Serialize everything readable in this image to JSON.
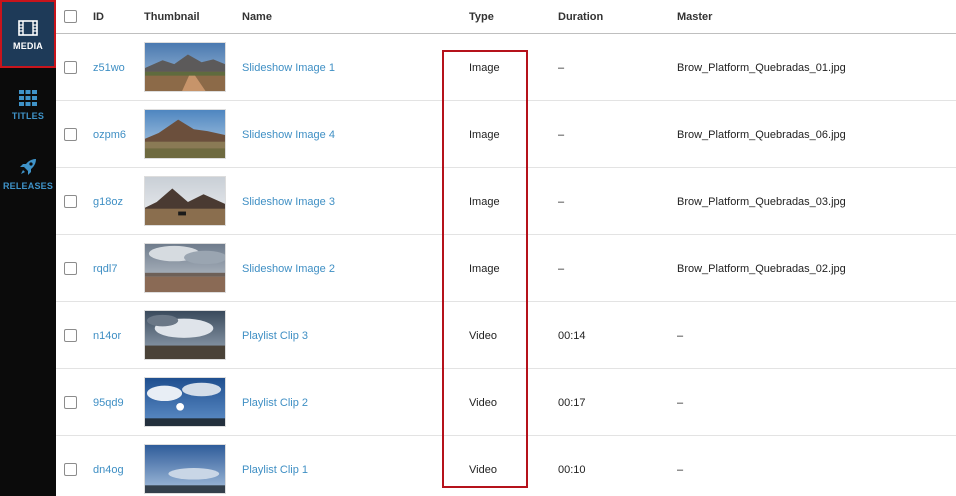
{
  "sidebar": {
    "items": [
      {
        "label": "MEDIA",
        "icon": "film-icon",
        "active": true
      },
      {
        "label": "TITLES",
        "icon": "grid-icon"
      },
      {
        "label": "RELEASES",
        "icon": "rocket-icon"
      }
    ]
  },
  "table": {
    "columns": [
      "ID",
      "Thumbnail",
      "Name",
      "Type",
      "Duration",
      "Master"
    ],
    "rows": [
      {
        "id": "z51wo",
        "name": "Slideshow Image 1",
        "type": "Image",
        "duration": "–",
        "master": "Brow_Platform_Quebradas_01.jpg"
      },
      {
        "id": "ozpm6",
        "name": "Slideshow Image 4",
        "type": "Image",
        "duration": "–",
        "master": "Brow_Platform_Quebradas_06.jpg"
      },
      {
        "id": "g18oz",
        "name": "Slideshow Image 3",
        "type": "Image",
        "duration": "–",
        "master": "Brow_Platform_Quebradas_03.jpg"
      },
      {
        "id": "rqdl7",
        "name": "Slideshow Image 2",
        "type": "Image",
        "duration": "–",
        "master": "Brow_Platform_Quebradas_02.jpg"
      },
      {
        "id": "n14or",
        "name": "Playlist Clip 3",
        "type": "Video",
        "duration": "00:14",
        "master": "–"
      },
      {
        "id": "95qd9",
        "name": "Playlist Clip 2",
        "type": "Video",
        "duration": "00:17",
        "master": "–"
      },
      {
        "id": "dn4og",
        "name": "Playlist Clip 1",
        "type": "Video",
        "duration": "00:10",
        "master": "–"
      }
    ]
  },
  "colors": {
    "sidebar_bg": "#0b0b0b",
    "active_nav_bg": "#1e3a58",
    "link": "#3f8fc4",
    "highlight": "#b5121b"
  }
}
